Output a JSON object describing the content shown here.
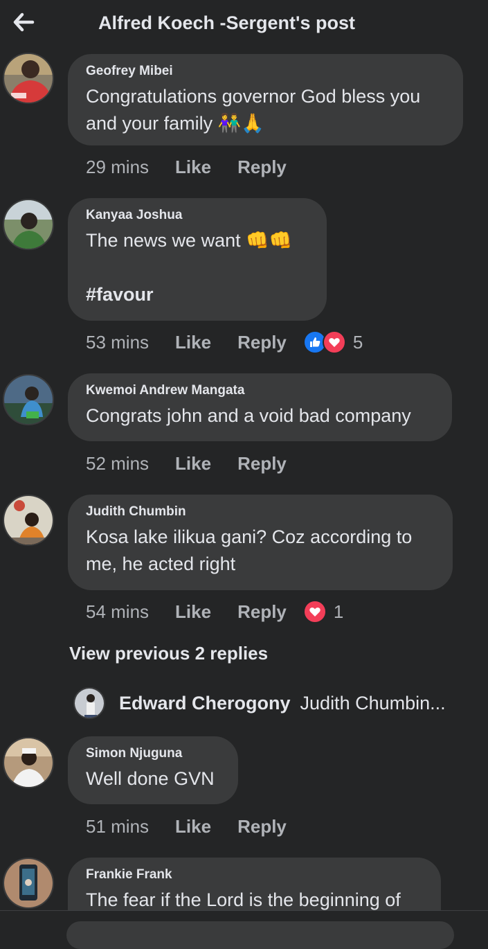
{
  "header": {
    "title": "Alfred Koech -Sergent's post"
  },
  "comments": [
    {
      "author": "Geofrey Mibei",
      "text": "Congratulations governor God bless you and your family 👫🙏",
      "time": "29 mins",
      "like_label": "Like",
      "reply_label": "Reply"
    },
    {
      "author": "Kanyaa Joshua",
      "text_line1": "The news we want 👊👊",
      "hashtag": "#favour",
      "time": "53 mins",
      "like_label": "Like",
      "reply_label": "Reply",
      "reactions": [
        "like-icon",
        "love-icon"
      ],
      "reaction_count": "5"
    },
    {
      "author": "Kwemoi Andrew Mangata",
      "text": "Congrats john and a void bad company",
      "time": "52 mins",
      "like_label": "Like",
      "reply_label": "Reply"
    },
    {
      "author": "Judith Chumbin",
      "text": "Kosa lake ilikua gani? Coz according to me, he acted right",
      "time": "54 mins",
      "like_label": "Like",
      "reply_label": "Reply",
      "reactions": [
        "love-icon"
      ],
      "reaction_count": "1",
      "view_previous": "View previous 2 replies",
      "reply_preview": {
        "author": "Edward Cherogony",
        "text": "Judith Chumbin..."
      }
    },
    {
      "author": "Simon Njuguna",
      "text": "Well done GVN",
      "time": "51 mins",
      "like_label": "Like",
      "reply_label": "Reply"
    },
    {
      "author": "Frankie Frank",
      "text": "The fear if the Lord is the beginning of"
    }
  ],
  "colors": {
    "background": "#242526",
    "bubble": "#3a3b3c",
    "text_primary": "#e4e6eb",
    "text_secondary": "#b0b3b8",
    "like_blue": "#1877f2",
    "love_red": "#f33e58"
  }
}
